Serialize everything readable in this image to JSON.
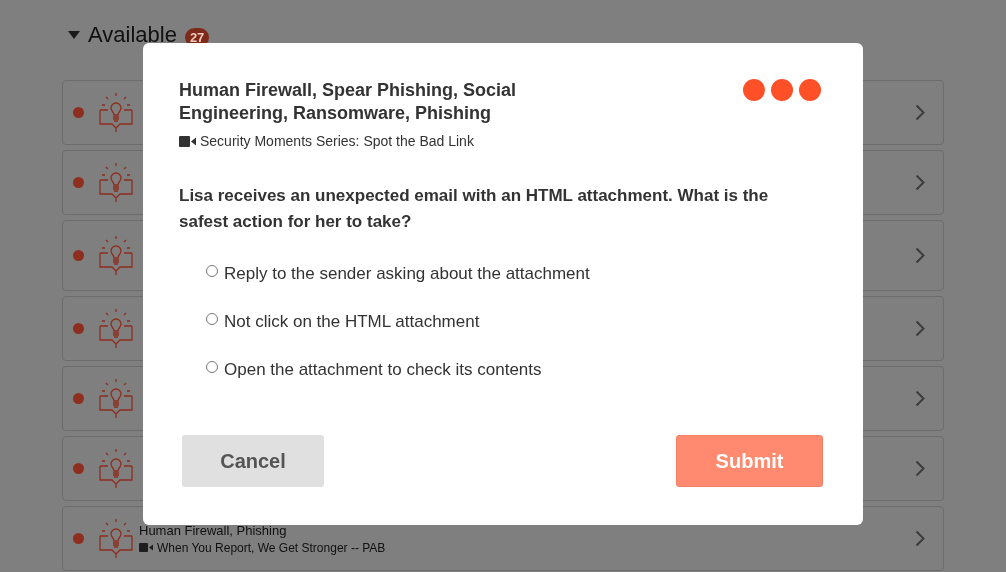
{
  "section": {
    "label": "Available",
    "count": "27",
    "expanded": true
  },
  "items": [
    {
      "kind": "covered",
      "unread": true
    },
    {
      "kind": "covered",
      "unread": true
    },
    {
      "kind": "covered-tall",
      "unread": true
    },
    {
      "kind": "covered",
      "unread": true
    },
    {
      "kind": "covered",
      "unread": true
    },
    {
      "kind": "covered",
      "unread": true
    },
    {
      "kind": "text",
      "unread": true,
      "title": "Human Firewall, Phishing",
      "subtitle": "When You Report, We Get Stronger -- PAB"
    }
  ],
  "dialog": {
    "title": "Human Firewall, Spear Phishing, Social Engineering, Ransomware, Phishing",
    "subtitle": "Security Moments Series: Spot the Bad Link",
    "question": "Lisa receives an unexpected email with an HTML attachment. What is the safest action for her to take?",
    "options": [
      {
        "label": "Reply to the sender asking about the attachment",
        "selected": false
      },
      {
        "label": "Not click on the HTML attachment",
        "selected": false
      },
      {
        "label": "Open the attachment to check its contents",
        "selected": false
      }
    ],
    "cancel": {
      "label": "Cancel"
    },
    "submit": {
      "label": "Submit",
      "disabled": true
    }
  }
}
